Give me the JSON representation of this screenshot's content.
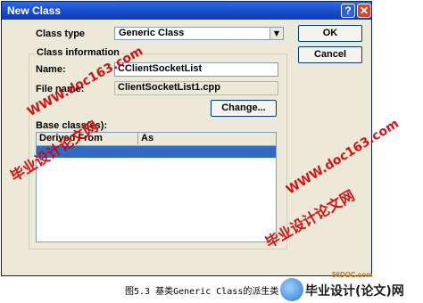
{
  "dialog": {
    "title": "New Class",
    "help_button": "?",
    "close_button": "✕"
  },
  "class_type": {
    "label": "Class type",
    "value": "Generic Class"
  },
  "buttons": {
    "ok": "OK",
    "cancel": "Cancel",
    "change": "Change..."
  },
  "class_information": {
    "group_label": "Class information",
    "name_label": "Name:",
    "name_value": "CClientSocketList",
    "file_name_label": "File name:",
    "file_name_value": "ClientSocketList1.cpp"
  },
  "base_classes": {
    "label": "Base class(es):",
    "columns": [
      "Derived From",
      "As"
    ]
  },
  "watermarks": {
    "domain": "WWW.doc163.com",
    "slogan": "毕业设计论文网"
  },
  "caption": "图5.3 基类Generic Class的派生类",
  "logo": {
    "site": "56DOC.com",
    "brand": "毕业设计(论文)网"
  },
  "colors": {
    "titlebar": "#0b3bb7",
    "selection": "#316ac5",
    "watermark": "#d40000"
  }
}
